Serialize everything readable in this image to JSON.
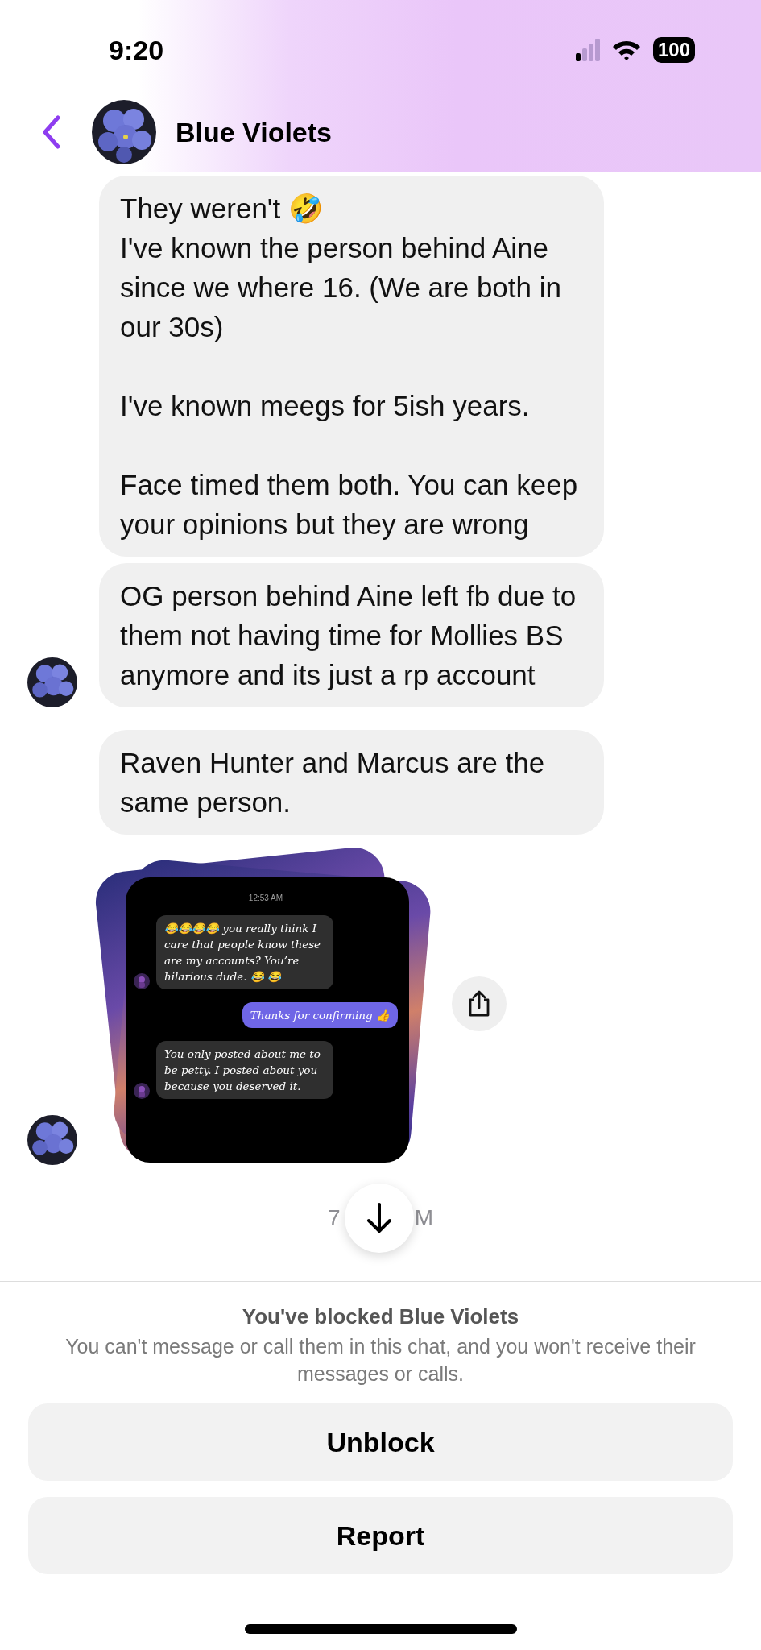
{
  "status_bar": {
    "time": "9:20",
    "battery": "100"
  },
  "header": {
    "title": "Blue Violets"
  },
  "messages": [
    {
      "kind": "text",
      "avatar": false,
      "text": "They weren't 🤣\nI've known the person behind Aine since we where 16. (We are both in our 30s)\n\nI've known meegs for 5ish years.\n\nFace timed them both. You can keep your opinions but they are wrong"
    },
    {
      "kind": "text",
      "avatar": true,
      "text": "OG person behind Aine left fb due to them not having time for Mollies BS anymore and its just a rp account"
    },
    {
      "kind": "text",
      "avatar": false,
      "text": "Raven Hunter and Marcus are the same person."
    },
    {
      "avatar": true,
      "screenshot": {
        "time": "12:53 AM",
        "messages": [
          {
            "kind": "incoming",
            "text": "😂😂😂😂 you really think I care that people know these are my accounts? You’re hilarious dude. 😂 😂"
          },
          {
            "kind": "outgoing",
            "text": "Thanks for confirming 👍"
          },
          {
            "kind": "incoming",
            "text": "You only posted about me to be petty. I posted about you because you deserved it."
          }
        ]
      }
    }
  ],
  "timestamp_fragments": [
    "7",
    "M"
  ],
  "blocked": {
    "title": "You've blocked Blue Violets",
    "text": "You can't message or call them in this chat, and you won't receive their messages or calls."
  },
  "buttons": [
    "Unblock",
    "Report"
  ]
}
